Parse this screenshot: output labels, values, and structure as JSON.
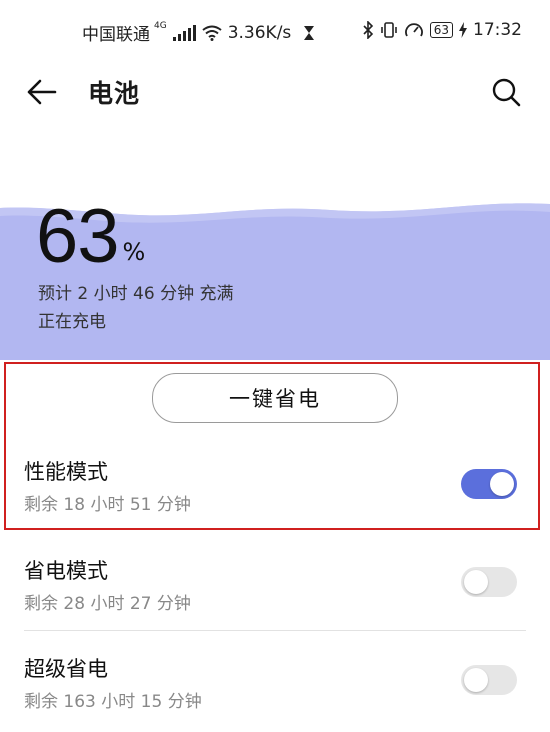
{
  "status_bar": {
    "carrier": "中国联通",
    "network": "4G",
    "speed": "3.36K/s",
    "battery_level": "63",
    "time": "17:32"
  },
  "header": {
    "title": "电池"
  },
  "battery": {
    "percent": "63",
    "percent_sign": "%",
    "estimate": "预计 2 小时 46 分钟 充满",
    "status": "正在充电"
  },
  "save_button": {
    "label": "一键省电"
  },
  "modes": [
    {
      "title": "性能模式",
      "remaining": "剩余 18 小时 51 分钟",
      "enabled": true
    },
    {
      "title": "省电模式",
      "remaining": "剩余 28 小时 27 分钟",
      "enabled": false
    },
    {
      "title": "超级省电",
      "remaining": "剩余 163 小时 15 分钟",
      "enabled": false
    }
  ],
  "colors": {
    "hero_bg": "#b2b7f1",
    "toggle_on": "#5b6fdc",
    "highlight_border": "#d0201f"
  }
}
